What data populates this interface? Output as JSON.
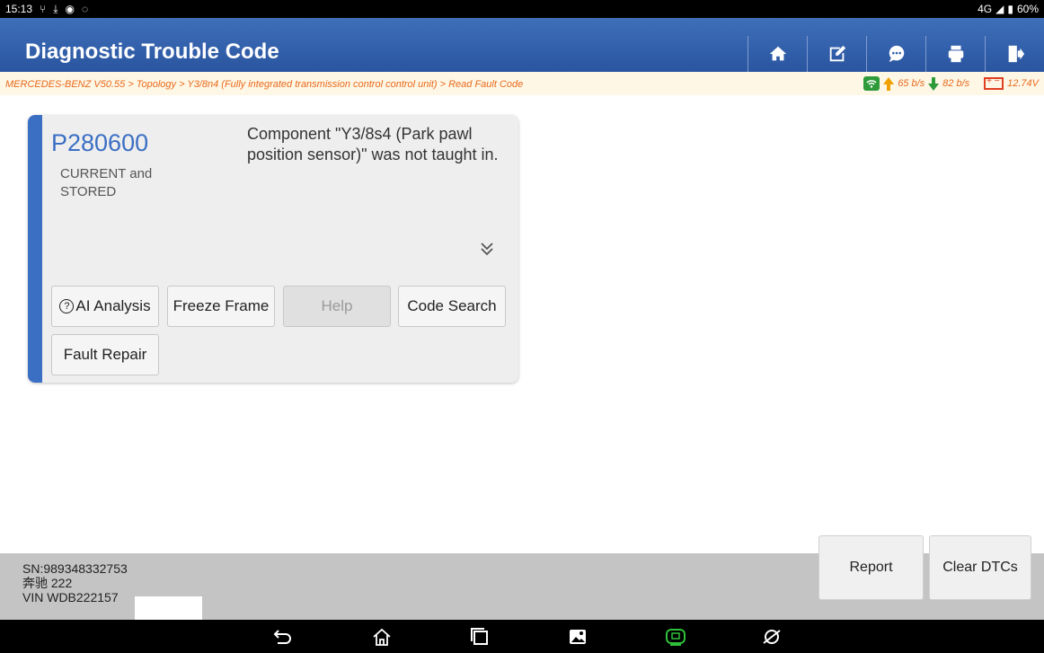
{
  "status_bar": {
    "time": "15:13",
    "left_icons": [
      "usb-icon",
      "download-icon",
      "settings-icon",
      "chat-icon"
    ],
    "network": "4G",
    "battery": "60%"
  },
  "header": {
    "title": "Diagnostic Trouble Code",
    "toolbar": [
      "home-icon",
      "edit-icon",
      "message-icon",
      "print-icon",
      "exit-icon"
    ]
  },
  "breadcrumb": {
    "path": "MERCEDES-BENZ V50.55 > Topology > Y3/8n4 (Fully integrated transmission control control unit) > Read Fault Code",
    "upload_rate": "65 b/s",
    "download_rate": "82 b/s",
    "voltage": "12.74V"
  },
  "dtc": {
    "code": "P280600",
    "status": "CURRENT and STORED",
    "description": "Component \"Y3/8s4 (Park pawl position sensor)\" was not taught in.",
    "buttons": {
      "ai_analysis": "AI Analysis",
      "freeze_frame": "Freeze Frame",
      "help": "Help",
      "code_search": "Code Search",
      "fault_repair": "Fault Repair"
    }
  },
  "footer": {
    "sn": "SN:989348332753",
    "model": "奔驰 222",
    "vin": "VIN WDB222157",
    "report": "Report",
    "clear": "Clear DTCs"
  },
  "nav_bar": [
    "back-icon",
    "home-icon",
    "recents-icon",
    "gallery-icon",
    "vci-icon",
    "browser-icon"
  ],
  "colors": {
    "header_blue": "#2f5ea8",
    "breadcrumb_orange": "#e86a1c",
    "code_blue": "#3b6fc4"
  }
}
